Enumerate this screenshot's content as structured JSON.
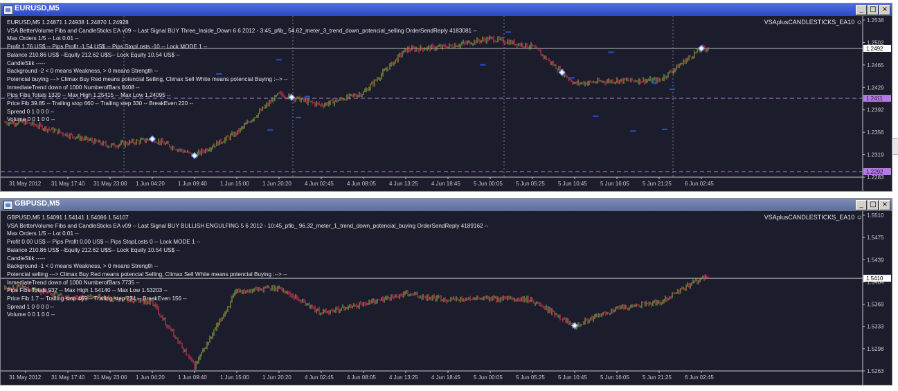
{
  "colors": {
    "background": "#1c1d2c",
    "grid": "#7a7a7a",
    "axis": "#c8c8c8",
    "candles": "#cc3355",
    "candles_up": "#8ca03c",
    "level_line": "#b47ae0",
    "bid_line": "#bdbdbd",
    "marker": "#7fb0ff",
    "title_active": "#2a49c4",
    "title_inactive": "#5d6d98"
  },
  "window_controls": [
    "_",
    "□",
    "×"
  ],
  "window_icon": "chart-window-icon",
  "windows": [
    {
      "title": "EURUSD,M5",
      "ea_name": "VSAplusCANDLESTICKS_EA10",
      "smiley": "smiley-icon",
      "info_lines": [
        "EURUSD,M5  1.24871 1.24938 1.24870 1.24928",
        "VSA BetterVolume Fibs and CandleSticks EA v09 -- Last Signal BUY Three_Inside_Down 6 6 2012 - 3:45_pfib_ 54.62_meter_3_trend_down_potencial_selling OrderSendReply 4183081 --",
        "Max Orders 1/5 -- Lot 0.01 --",
        "Profit 1.76 US$ -- Pips Profit -1.54 US$ -- Pips StopLosts -10 -- Lock MODE 1 --",
        "Balance 210.86 US$ --Equity 212.62 U$S-- Lock Equity 10.54 US$ --",
        "CandleStik  -----",
        "Background -2 < 0 means Weakness, > 0 means Strength  --",
        "Potencial buying ---> Climax Buy Red means potencial Selling, Climax Sell White means potencial Buying :--> --",
        "InmediateTrend down of 1000 NumberofBars 8408 --",
        "Pips Fibs Totals 1320 --  Max High 1.25415 -- Max Low 1.24095 --",
        "Price Fib 39.85 -- Trailing stop 660 -- Trailing step 330 -- BreakEven 220 --",
        "Spread 0    1    0    0    0 --",
        "Volume 0    0    1    0    0 --"
      ],
      "price_labels": [
        "1.2538",
        "1.2502",
        "1.2465",
        "1.2429",
        "1.2392",
        "1.2356",
        "1.2319",
        "1.2283"
      ],
      "current_price": "1.2492",
      "level_labels": [
        "1.2411",
        "1.2292"
      ],
      "time_labels": [
        "31 May 2012",
        "31 May 17:40",
        "31 May 23:00",
        "1 Jun 04:20",
        "1 Jun 09:40",
        "1 Jun 15:00",
        "1 Jun 20:20",
        "4 Jun 02:45",
        "4 Jun 08:05",
        "4 Jun 13:25",
        "4 Jun 18:45",
        "5 Jun 00:05",
        "5 Jun 05:25",
        "5 Jun 10:45",
        "5 Jun 16:05",
        "5 Jun 21:25",
        "6 Jun 02:45"
      ]
    },
    {
      "title": "GBPUSD,M5",
      "ea_name": "VSAplusCANDLESTICKS_EA10",
      "smiley": "smiley-icon",
      "info_lines": [
        "GBPUSD,M5  1.54091 1.54141 1.54086 1.54107",
        "VSA BetterVolume Fibs and CandleSticks EA v09 -- Last Signal BUY BULLISH ENGULFING 5 6 2012 - 10:45_pfib_ 96.32_meter_1_trend_down_potencial_buying OrderSendReply 4189162 --",
        "Max Orders 1/5 -- Lot 0.01 --",
        "Profit 0.00 US$ -- Pips Profit 0.00 US$ -- Pips StopLosts 0 -- Lock MODE 1 --",
        "Balance 210.86 US$ --Equity 212.62 U$S-- Lock Equity 10.54 US$ --",
        "CandleStik  -----",
        "Background -1 < 0 means Weakness, > 0 means Strength  --",
        "Potencial selling ---> Climax Buy Red means potencial Selling, Climax Sell White means potencial Buying :--> --",
        "InmediateTrend down of 1000 NumberofBars 7735 --",
        "Pips Fibs Totals 937 --  Max High 1.54140 -- Max Low 1.53203 --",
        "Price Fib 1.7 -- Trailing stop 469 -- Trailing step 234 -- BreakEven 156 --",
        "Spread 1    0    0    0    0 --",
        "Volume 0    0    1    0    0 --"
      ],
      "price_labels": [
        "1.5510",
        "1.5475",
        "1.5439",
        "1.5404",
        "1.5369",
        "1.5333",
        "1.5298",
        "1.5263"
      ],
      "current_price": "1.5410",
      "level_labels": [],
      "time_labels": [
        "31 May 2012",
        "31 May 17:40",
        "31 May 23:00",
        "1 Jun 04:20",
        "1 Jun 09:40",
        "1 Jun 15:00",
        "1 Jun 20:20",
        "4 Jun 02:45",
        "4 Jun 08:05",
        "4 Jun 13:25",
        "4 Jun 18:45",
        "5 Jun 00:05",
        "5 Jun 05:25",
        "5 Jun 10:45",
        "5 Jun 16:05",
        "5 Jun 21:25",
        "6 Jun 02:45"
      ]
    }
  ],
  "chart_data": [
    {
      "type": "line",
      "title": "EURUSD,M5",
      "x": [
        "31 May 2012",
        "31 May 17:40",
        "31 May 23:00",
        "1 Jun 04:20",
        "1 Jun 09:40",
        "1 Jun 15:00",
        "1 Jun 20:20",
        "4 Jun 02:45",
        "4 Jun 08:05",
        "4 Jun 13:25",
        "4 Jun 18:45",
        "5 Jun 00:05",
        "5 Jun 05:25",
        "5 Jun 10:45",
        "5 Jun 16:05",
        "5 Jun 21:25",
        "6 Jun 02:45"
      ],
      "series": [
        {
          "values": [
            1.2372,
            1.2352,
            1.2334,
            1.2345,
            1.2318,
            1.2355,
            1.2418,
            1.24,
            1.242,
            1.249,
            1.2495,
            1.2508,
            1.2495,
            1.2435,
            1.244,
            1.244,
            1.2492
          ]
        }
      ],
      "ylim": [
        1.2283,
        1.2538
      ],
      "hlines": [
        1.2411,
        1.2292
      ],
      "current_price": 1.2492,
      "grid": true
    },
    {
      "type": "line",
      "title": "GBPUSD,M5",
      "x": [
        "31 May 2012",
        "31 May 17:40",
        "31 May 23:00",
        "1 Jun 04:20",
        "1 Jun 09:40",
        "1 Jun 15:00",
        "1 Jun 20:20",
        "4 Jun 02:45",
        "4 Jun 08:05",
        "4 Jun 13:25",
        "4 Jun 18:45",
        "5 Jun 00:05",
        "5 Jun 05:25",
        "5 Jun 10:45",
        "5 Jun 16:05",
        "5 Jun 21:25",
        "6 Jun 02:45"
      ],
      "series": [
        {
          "values": [
            1.5395,
            1.538,
            1.5378,
            1.5372,
            1.527,
            1.539,
            1.5395,
            1.5355,
            1.537,
            1.5385,
            1.5376,
            1.5378,
            1.5375,
            1.5335,
            1.5362,
            1.5372,
            1.541
          ]
        }
      ],
      "ylim": [
        1.5263,
        1.551
      ],
      "current_price": 1.541,
      "grid": false
    }
  ]
}
